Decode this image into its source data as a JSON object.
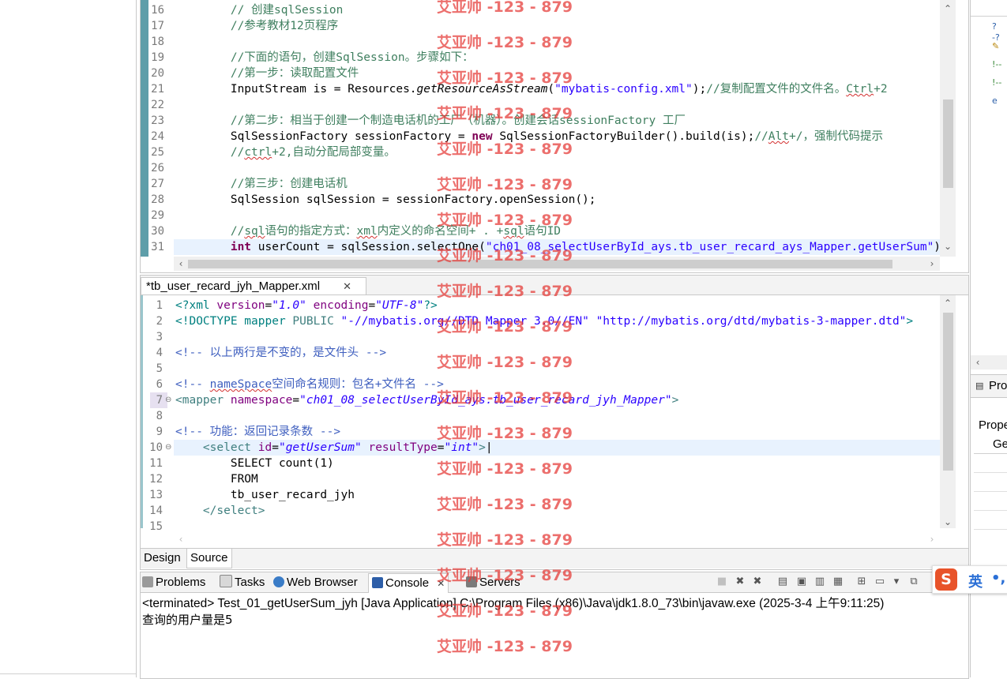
{
  "java_editor": {
    "lines": [
      {
        "n": "16",
        "html": "        <span class=\"cmt\">// 创建sqlSession</span>"
      },
      {
        "n": "17",
        "html": "        <span class=\"cmt\">//参考教材12页程序</span>"
      },
      {
        "n": "18",
        "html": ""
      },
      {
        "n": "19",
        "html": "        <span class=\"cmt\">//下面的语句，创建SqlSession。步骤如下：</span>"
      },
      {
        "n": "20",
        "html": "        <span class=\"cmt\">//第一步：读取配置文件</span>"
      },
      {
        "n": "21",
        "html": "        InputStream is = Resources.<span class=\"it\">getResourceAsStream</span>(<span class=\"str\">\"mybatis-config.xml\"</span>);<span class=\"cmt\">//复制配置文件的文件名。<span class=\"sq\">Ctrl</span>+2</span>"
      },
      {
        "n": "22",
        "html": ""
      },
      {
        "n": "23",
        "html": "        <span class=\"cmt\">//第二步：相当于创建一个制造电话机的工厂（机器）。创建会话sessionFactory 工厂</span>"
      },
      {
        "n": "24",
        "html": "        SqlSessionFactory sessionFactory = <span class=\"kw\">new</span> SqlSessionFactoryBuilder().build(is);<span class=\"cmt\">//<span class=\"sq\">Alt</span>+/，强制代码提示</span>"
      },
      {
        "n": "25",
        "html": "        <span class=\"cmt\">//<span class=\"sq\">ctrl</span>+2,自动分配局部变量。</span>"
      },
      {
        "n": "26",
        "html": ""
      },
      {
        "n": "27",
        "html": "        <span class=\"cmt\">//第三步：创建电话机</span>"
      },
      {
        "n": "28",
        "html": "        SqlSession sqlSession = sessionFactory.openSession();"
      },
      {
        "n": "29",
        "html": ""
      },
      {
        "n": "30",
        "html": "        <span class=\"cmt\">//<span class=\"sq\">sql</span>语句的指定方式：<span class=\"sq\">xml</span>内定义的命名空间+ . +<span class=\"sq\">sql</span>语句ID</span>"
      },
      {
        "n": "31",
        "html": "        <span class=\"kw\">int</span> userCount = sqlSession.selectOne(<span class=\"str\">\"ch01_08_selectUserById_ays.tb_user_recard_ays_Mapper.getUserSum\"</span>);"
      }
    ]
  },
  "xml_editor": {
    "tab_label": "*tb_user_recard_jyh_Mapper.xml",
    "tab_close": "✕",
    "lines": [
      {
        "n": "1",
        "html": "<span class=\"xml-decl\">&lt;?xml</span> <span class=\"xml-attr\">version</span>=<span class=\"xml-val\">\"1.0\"</span> <span class=\"xml-attr\">encoding</span>=<span class=\"xml-val\">\"UTF-8\"</span><span class=\"xml-decl\">?&gt;</span>"
      },
      {
        "n": "2",
        "html": "<span class=\"xml-decl\">&lt;!DOCTYPE mapper</span> <span class=\"xml-tag\">PUBLIC</span> <span class=\"str\">\"-//mybatis.org//DTD Mapper 3.0//EN\"</span> <span class=\"str\">\"http://mybatis.org/dtd/mybatis-3-mapper.dtd\"</span><span class=\"xml-decl\">&gt;</span>"
      },
      {
        "n": "3",
        "html": ""
      },
      {
        "n": "4",
        "html": "<span class=\"xml-cmt\">&lt;!-- 以上两行是不变的，是文件头 --&gt;</span>"
      },
      {
        "n": "5",
        "html": ""
      },
      {
        "n": "6",
        "html": "<span class=\"xml-cmt\">&lt;!-- <span class=\"sq\">nameSpace</span>空间命名规则：包名+文件名 --&gt;</span>"
      },
      {
        "n": "7",
        "html": "<span class=\"xml-tag\">&lt;mapper</span> <span class=\"xml-attr\">namespace</span>=<span class=\"xml-val\">\"ch01_08_selectUserById_ays.tb_user_recard_jyh_Mapper\"</span><span class=\"xml-tag\">&gt;</span>"
      },
      {
        "n": "8",
        "html": ""
      },
      {
        "n": "9",
        "html": "<span class=\"xml-cmt\">&lt;!-- 功能：返回记录条数 --&gt;</span>"
      },
      {
        "n": "10",
        "html": "    <span class=\"xml-tag\">&lt;select</span> <span class=\"xml-attr\">id</span>=<span class=\"xml-val\">\"getUserSum\"</span> <span class=\"xml-attr\">resultType</span>=<span class=\"xml-val\">\"int\"</span><span class=\"xml-tag\">&gt;</span>|"
      },
      {
        "n": "11",
        "html": "        SELECT count(1)"
      },
      {
        "n": "12",
        "html": "        FROM"
      },
      {
        "n": "13",
        "html": "        tb_user_recard_jyh"
      },
      {
        "n": "14",
        "html": "    <span class=\"xml-tag\">&lt;/select&gt;</span>"
      },
      {
        "n": "15",
        "html": ""
      }
    ],
    "bottom_tabs": [
      "Design",
      "Source"
    ]
  },
  "console": {
    "tabs": [
      "Problems",
      "Tasks",
      "Web Browser",
      "Console",
      "Servers"
    ],
    "status": "<terminated> Test_01_getUserSum_jyh [Java Application] C:\\Program Files (x86)\\Java\\jdk1.8.0_73\\bin\\javaw.exe (2025-3-4 上午9:11:25)",
    "output": "查询的用户量是5"
  },
  "right_pane": {
    "panel_title": "Pro",
    "labels": [
      "Prope",
      "Ge"
    ]
  },
  "ime": {
    "label": "英",
    "brand_letter": "S"
  },
  "watermark": "艾亚帅 -123 - 879"
}
